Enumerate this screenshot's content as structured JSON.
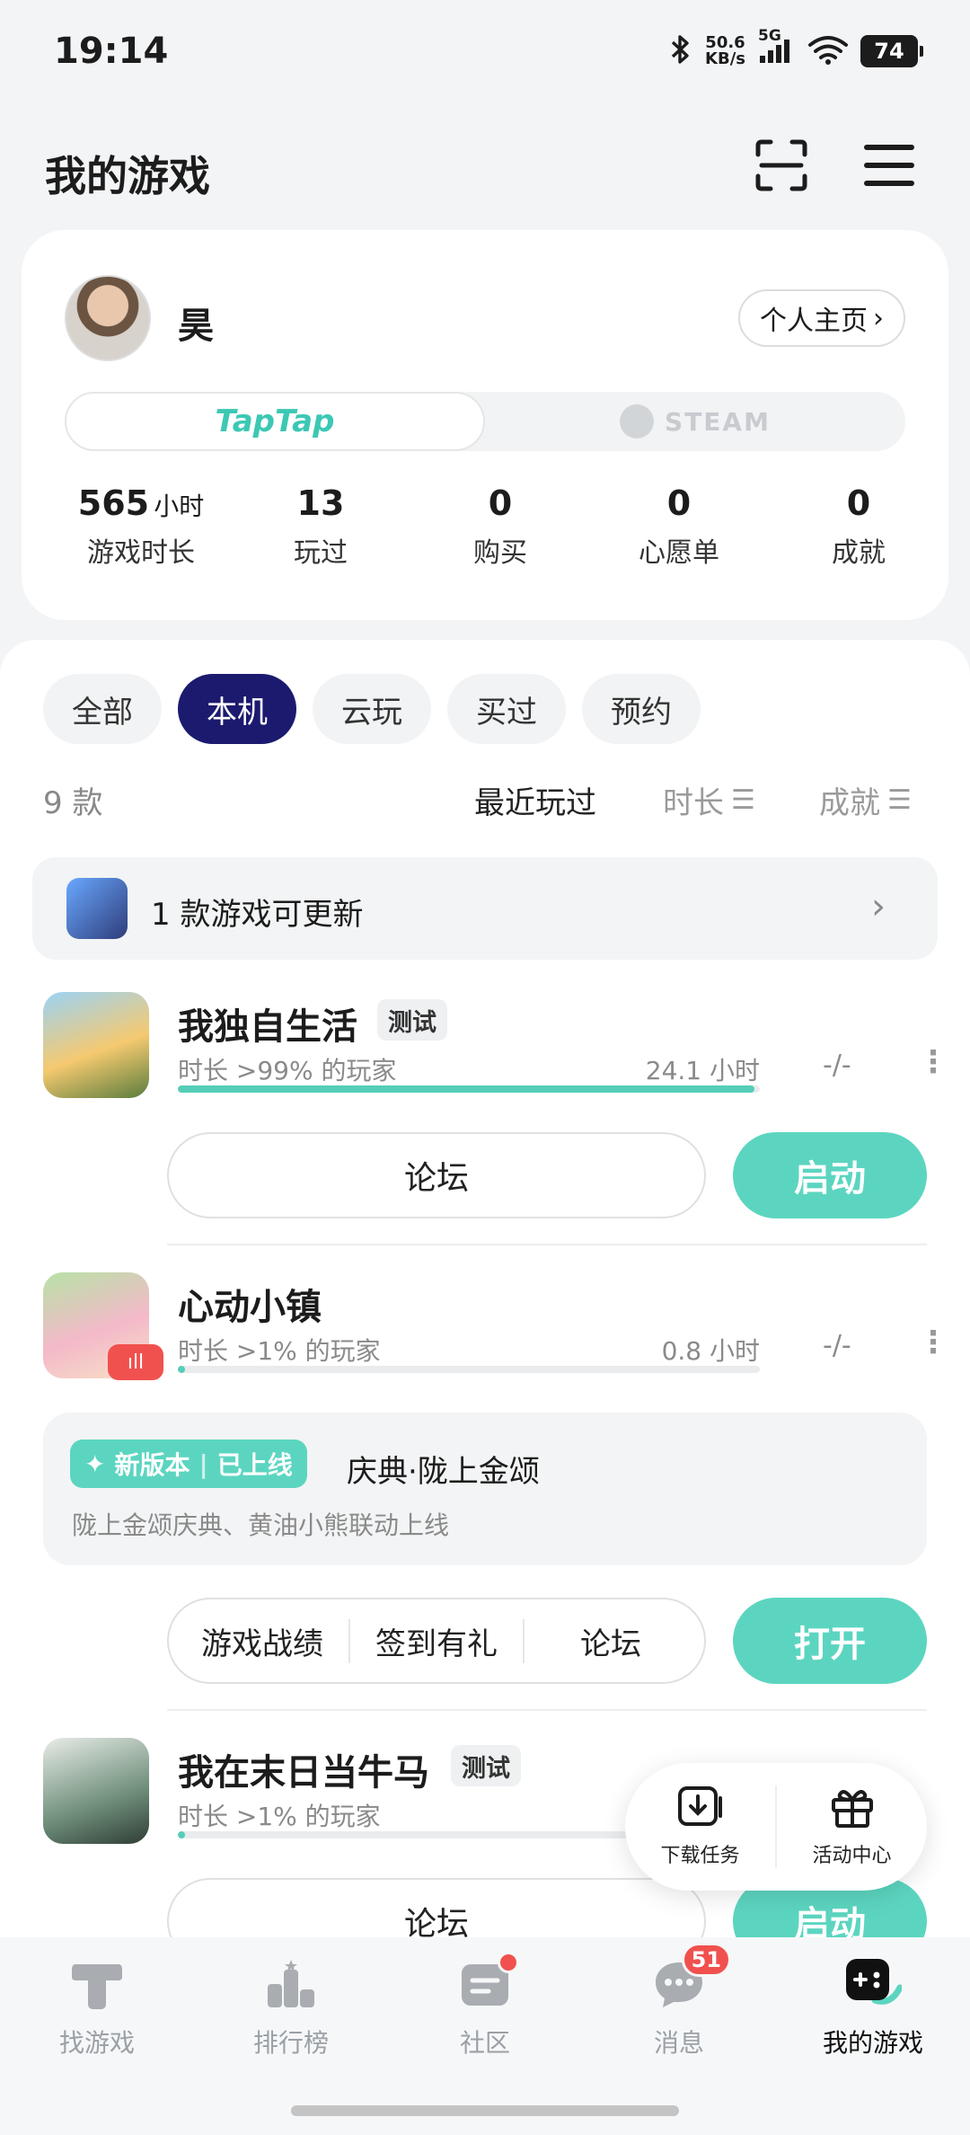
{
  "status_bar": {
    "time": "19:14",
    "net_speed": "50.6",
    "net_unit": "KB/s",
    "network": "5G",
    "battery": "74"
  },
  "header": {
    "title": "我的游戏",
    "scan_icon": "scan-icon",
    "menu_icon": "menu-icon"
  },
  "profile": {
    "name": "昊",
    "home_button": "个人主页",
    "platforms": [
      {
        "label": "TapTap",
        "active": true
      },
      {
        "label": "STEAM",
        "active": false
      }
    ],
    "stats": [
      {
        "value": "565",
        "unit": "小时",
        "label": "游戏时长"
      },
      {
        "value": "13",
        "unit": "",
        "label": "玩过"
      },
      {
        "value": "0",
        "unit": "",
        "label": "购买"
      },
      {
        "value": "0",
        "unit": "",
        "label": "心愿单"
      },
      {
        "value": "0",
        "unit": "",
        "label": "成就"
      }
    ]
  },
  "filters": [
    {
      "label": "全部",
      "active": false
    },
    {
      "label": "本机",
      "active": true
    },
    {
      "label": "云玩",
      "active": false
    },
    {
      "label": "买过",
      "active": false
    },
    {
      "label": "预约",
      "active": false
    }
  ],
  "list_header": {
    "count": "9 款",
    "sort_recent": "最近玩过",
    "sort_duration": "时长",
    "sort_achievement": "成就"
  },
  "update_banner": {
    "text": "1 款游戏可更新"
  },
  "games": [
    {
      "name": "我独自生活",
      "tag": "测试",
      "rank_text": "时长 >99% 的玩家",
      "hours": "24.1 小时",
      "rank_fraction": 0.99,
      "achievement": "-/-",
      "actions": [
        "论坛"
      ],
      "primary": "启动"
    },
    {
      "name": "心动小镇",
      "tag": "",
      "rank_text": "时长 >1% 的玩家",
      "hours": "0.8 小时",
      "rank_fraction": 0.01,
      "achievement": "-/-",
      "actions": [
        "游戏战绩",
        "签到有礼",
        "论坛"
      ],
      "primary": "打开",
      "news": {
        "badge_new": "新版本",
        "badge_live": "已上线",
        "title": "庆典·陇上金颂",
        "desc": "陇上金颂庆典、黄油小熊联动上线"
      }
    },
    {
      "name": "我在末日当牛马",
      "tag": "测试",
      "rank_text": "时长 >1% 的玩家",
      "hours": "",
      "rank_fraction": 0.01,
      "achievement": "",
      "actions": [
        "论坛"
      ],
      "primary": "启动"
    }
  ],
  "float_panel": {
    "download": "下载任务",
    "activity": "活动中心"
  },
  "bottom_nav": [
    {
      "label": "找游戏",
      "icon": "find-game-icon",
      "active": false
    },
    {
      "label": "排行榜",
      "icon": "ranking-icon",
      "active": false
    },
    {
      "label": "社区",
      "icon": "community-icon",
      "active": false
    },
    {
      "label": "消息",
      "icon": "message-icon",
      "active": false,
      "badge": "51"
    },
    {
      "label": "我的游戏",
      "icon": "my-games-icon",
      "active": true
    }
  ],
  "colors": {
    "accent": "#5cd5c0",
    "filter_active": "#1b1a6e",
    "badge": "#f0514e"
  }
}
